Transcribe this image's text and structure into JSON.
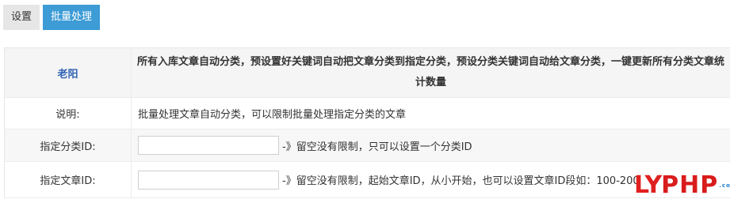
{
  "tabs": [
    {
      "label": "设置",
      "active": false
    },
    {
      "label": "批量处理",
      "active": true
    }
  ],
  "header": {
    "author": "老阳",
    "description": "所有入库文章自动分类，预设置好关键词自动把文章分类到指定分类，预设分类关键词自动给文章分类，一键更新所有分类文章统计数量"
  },
  "desc_row": {
    "label": "说明:",
    "text": "批量处理文章自动分类，可以限制批量处理指定分类的文章"
  },
  "category_field": {
    "label": "指定分类ID:",
    "value": "",
    "hint": "-》留空没有限制，只可以设置一个分类ID"
  },
  "article_field": {
    "label": "指定文章ID:",
    "value": "",
    "hint": "-》留空没有限制，起始文章ID，从小开始，也可以设置文章ID段如：100-200"
  },
  "watermark": {
    "brand": "LYPHP",
    "brand_part1": "LY",
    "brand_part2": "PHP",
    "suffix": ".com"
  },
  "colors": {
    "active_tab": "#3d9bd6",
    "author_link": "#2f63b5",
    "watermark_red": "#e02020",
    "watermark_blue": "#1a7ed0"
  }
}
